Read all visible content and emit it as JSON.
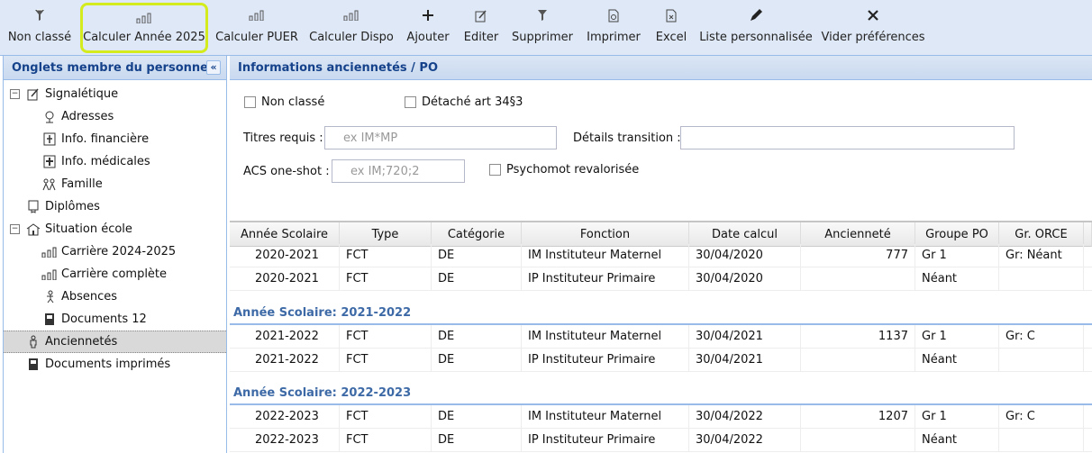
{
  "toolbar": {
    "items": [
      {
        "label": "Non classé",
        "icon": "filter-icon"
      },
      {
        "label": "Calculer Année 2025",
        "icon": "bar-chart-icon"
      },
      {
        "label": "Calculer PUER",
        "icon": "bar-chart-icon"
      },
      {
        "label": "Calculer Dispo",
        "icon": "bar-chart-icon"
      },
      {
        "label": "Ajouter",
        "icon": "plus-icon"
      },
      {
        "label": "Editer",
        "icon": "edit-icon"
      },
      {
        "label": "Supprimer",
        "icon": "filter-icon"
      },
      {
        "label": "Imprimer",
        "icon": "print-icon"
      },
      {
        "label": "Excel",
        "icon": "excel-icon"
      },
      {
        "label": "Liste personnalisée",
        "icon": "pencil-icon"
      },
      {
        "label": "Vider préférences",
        "icon": "close-icon"
      }
    ]
  },
  "left_panel": {
    "title": "Onglets membre du personnel",
    "collapse_glyph": "«",
    "tree": [
      {
        "label": "Signalétique",
        "expander": "−"
      },
      {
        "label": "Adresses"
      },
      {
        "label": "Info. financière"
      },
      {
        "label": "Info. médicales"
      },
      {
        "label": "Famille"
      },
      {
        "label": "Diplômes"
      },
      {
        "label": "Situation école",
        "expander": "−"
      },
      {
        "label": "Carrière 2024-2025"
      },
      {
        "label": "Carrière complète"
      },
      {
        "label": "Absences"
      },
      {
        "label": "Documents 12"
      },
      {
        "label": "Anciennetés"
      },
      {
        "label": "Documents imprimés"
      }
    ]
  },
  "right_panel": {
    "title": "Informations anciennetés / PO",
    "form": {
      "non_classe": "Non classé",
      "detache": "Détaché art 34§3",
      "titres_label": "Titres requis :",
      "titres_placeholder": "ex IM*MP",
      "details_label": "Détails transition :",
      "details_value": "",
      "acs_label": "ACS one-shot :",
      "acs_placeholder": "ex IM;720;2",
      "psychomot": "Psychomot revalorisée"
    },
    "grid": {
      "columns": [
        "Année Scolaire",
        "Type",
        "Catégorie",
        "Fonction",
        "Date calcul",
        "Ancienneté",
        "Groupe PO",
        "Gr. ORCE"
      ],
      "top_rows": [
        [
          "2020-2021",
          "FCT",
          "DE",
          "IM Instituteur Maternel",
          "30/04/2020",
          "777",
          "Gr 1",
          "Gr: Néant"
        ],
        [
          "2020-2021",
          "FCT",
          "DE",
          "IP Instituteur Primaire",
          "30/04/2020",
          "",
          "Néant",
          ""
        ]
      ],
      "groups": [
        {
          "title": "Année Scolaire: 2021-2022",
          "rows": [
            [
              "2021-2022",
              "FCT",
              "DE",
              "IM Instituteur Maternel",
              "30/04/2021",
              "1137",
              "Gr 1",
              "Gr: C"
            ],
            [
              "2021-2022",
              "FCT",
              "DE",
              "IP Instituteur Primaire",
              "30/04/2021",
              "",
              "Néant",
              ""
            ]
          ]
        },
        {
          "title": "Année Scolaire: 2022-2023",
          "rows": [
            [
              "2022-2023",
              "FCT",
              "DE",
              "IM Instituteur Maternel",
              "30/04/2022",
              "1207",
              "Gr 1",
              "Gr: C"
            ],
            [
              "2022-2023",
              "FCT",
              "DE",
              "IP Instituteur Primaire",
              "30/04/2022",
              "",
              "Néant",
              ""
            ]
          ]
        }
      ]
    }
  }
}
